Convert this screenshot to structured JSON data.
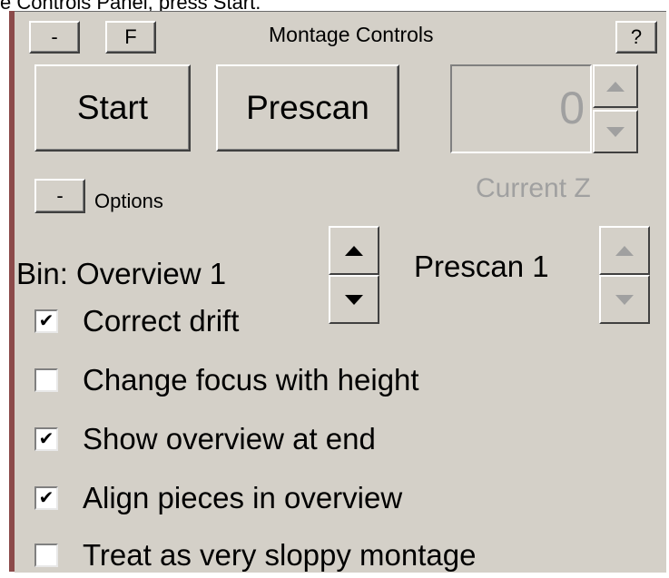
{
  "caption": "e Controls Panel, press Start.",
  "panel": {
    "collapse_label": "-",
    "float_label": "F",
    "title": "Montage Controls",
    "help_label": "?"
  },
  "buttons": {
    "start_label": "Start",
    "prescan_label": "Prescan"
  },
  "z_spinner": {
    "value": "0",
    "label": "Current Z"
  },
  "options": {
    "toggle_label": "-",
    "label": "Options"
  },
  "bin": {
    "overview_label": "Bin: Overview 1",
    "prescan_label": "Prescan 1"
  },
  "checkboxes": [
    {
      "label": "Correct drift",
      "checked": true
    },
    {
      "label": "Change focus with height",
      "checked": false
    },
    {
      "label": "Show overview at end",
      "checked": true
    },
    {
      "label": "Align pieces in overview",
      "checked": true
    },
    {
      "label": "Treat as very sloppy montage",
      "checked": false
    }
  ],
  "icons": {
    "up_arrow": "triangle-up",
    "down_arrow": "triangle-down",
    "check_mark": "✔"
  }
}
